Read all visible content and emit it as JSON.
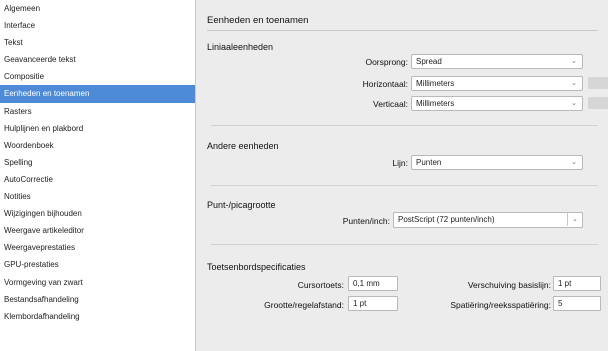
{
  "sidebar": {
    "items": [
      {
        "label": "Algemeen",
        "selected": false
      },
      {
        "label": "Interface",
        "selected": false
      },
      {
        "label": "Tekst",
        "selected": false
      },
      {
        "label": "Geavanceerde tekst",
        "selected": false
      },
      {
        "label": "Compositie",
        "selected": false
      },
      {
        "label": "Eenheden en toenamen",
        "selected": true
      },
      {
        "label": "Rasters",
        "selected": false
      },
      {
        "label": "Hulplijnen en plakbord",
        "selected": false
      },
      {
        "label": "Woordenboek",
        "selected": false
      },
      {
        "label": "Spelling",
        "selected": false
      },
      {
        "label": "AutoCorrectie",
        "selected": false
      },
      {
        "label": "Notities",
        "selected": false
      },
      {
        "label": "Wijzigingen bijhouden",
        "selected": false
      },
      {
        "label": "Weergave artikeleditor",
        "selected": false
      },
      {
        "label": "Weergaveprestaties",
        "selected": false
      },
      {
        "label": "GPU-prestaties",
        "selected": false
      },
      {
        "label": "Vormgeving van zwart",
        "selected": false
      },
      {
        "label": "Bestandsafhandeling",
        "selected": false
      },
      {
        "label": "Klembordafhandeling",
        "selected": false
      }
    ]
  },
  "panel": {
    "title": "Eenheden en toenamen",
    "ruler": {
      "title": "Liniaaleenheden",
      "origin_label": "Oorsprong:",
      "origin_value": "Spread",
      "horizontal_label": "Horizontaal:",
      "horizontal_value": "Millimeters",
      "vertical_label": "Verticaal:",
      "vertical_value": "Millimeters"
    },
    "other": {
      "title": "Andere eenheden",
      "stroke_label": "Lijn:",
      "stroke_value": "Punten"
    },
    "point": {
      "title": "Punt-/picagrootte",
      "ppi_label": "Punten/inch:",
      "ppi_value": "PostScript (72 punten/inch)"
    },
    "keyboard": {
      "title": "Toetsenbordspecificaties",
      "cursor_label": "Cursortoets:",
      "cursor_value": "0,1 mm",
      "size_label": "Grootte/regelafstand:",
      "size_value": "1 pt",
      "baseline_label": "Verschuiving basislijn:",
      "baseline_value": "1 pt",
      "kerning_label": "Spatiëring/reeksspatiëring:",
      "kerning_value": "5"
    }
  },
  "colors": {
    "selection": "#4d8bd8",
    "window_bg": "#ececec"
  }
}
